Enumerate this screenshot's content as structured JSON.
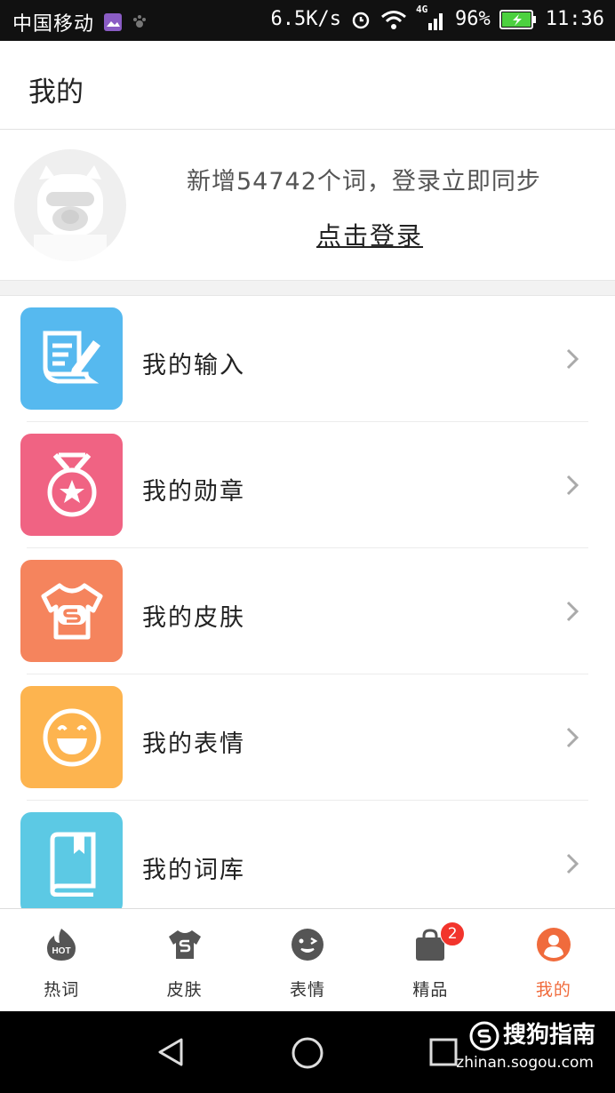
{
  "status_bar": {
    "carrier": "中国移动",
    "net_speed": "6.5K/s",
    "network_type": "4G",
    "battery_percent": "96%",
    "time": "11:36"
  },
  "header": {
    "title": "我的"
  },
  "profile": {
    "promo_text": "新增54742个词，登录立即同步",
    "login_link": "点击登录"
  },
  "menu": {
    "items": [
      {
        "label": "我的输入",
        "icon": "edit-document-icon",
        "color": "#56b9ef"
      },
      {
        "label": "我的勋章",
        "icon": "medal-icon",
        "color": "#f06383"
      },
      {
        "label": "我的皮肤",
        "icon": "tshirt-icon",
        "color": "#f5845d"
      },
      {
        "label": "我的表情",
        "icon": "smiley-icon",
        "color": "#fdb44f"
      },
      {
        "label": "我的词库",
        "icon": "book-icon",
        "color": "#5cc9e4"
      }
    ]
  },
  "tabs": {
    "items": [
      {
        "label": "热词",
        "icon": "hot-icon",
        "icon_text": "HOT"
      },
      {
        "label": "皮肤",
        "icon": "tshirt-icon"
      },
      {
        "label": "表情",
        "icon": "wink-icon"
      },
      {
        "label": "精品",
        "icon": "shopping-bag-icon",
        "badge": "2"
      },
      {
        "label": "我的",
        "icon": "user-icon",
        "active": true
      }
    ]
  },
  "colors": {
    "accent": "#f06b3c",
    "badge": "#f2342c"
  },
  "watermark": {
    "brand": "搜狗指南",
    "url": "zhinan.sogou.com"
  }
}
